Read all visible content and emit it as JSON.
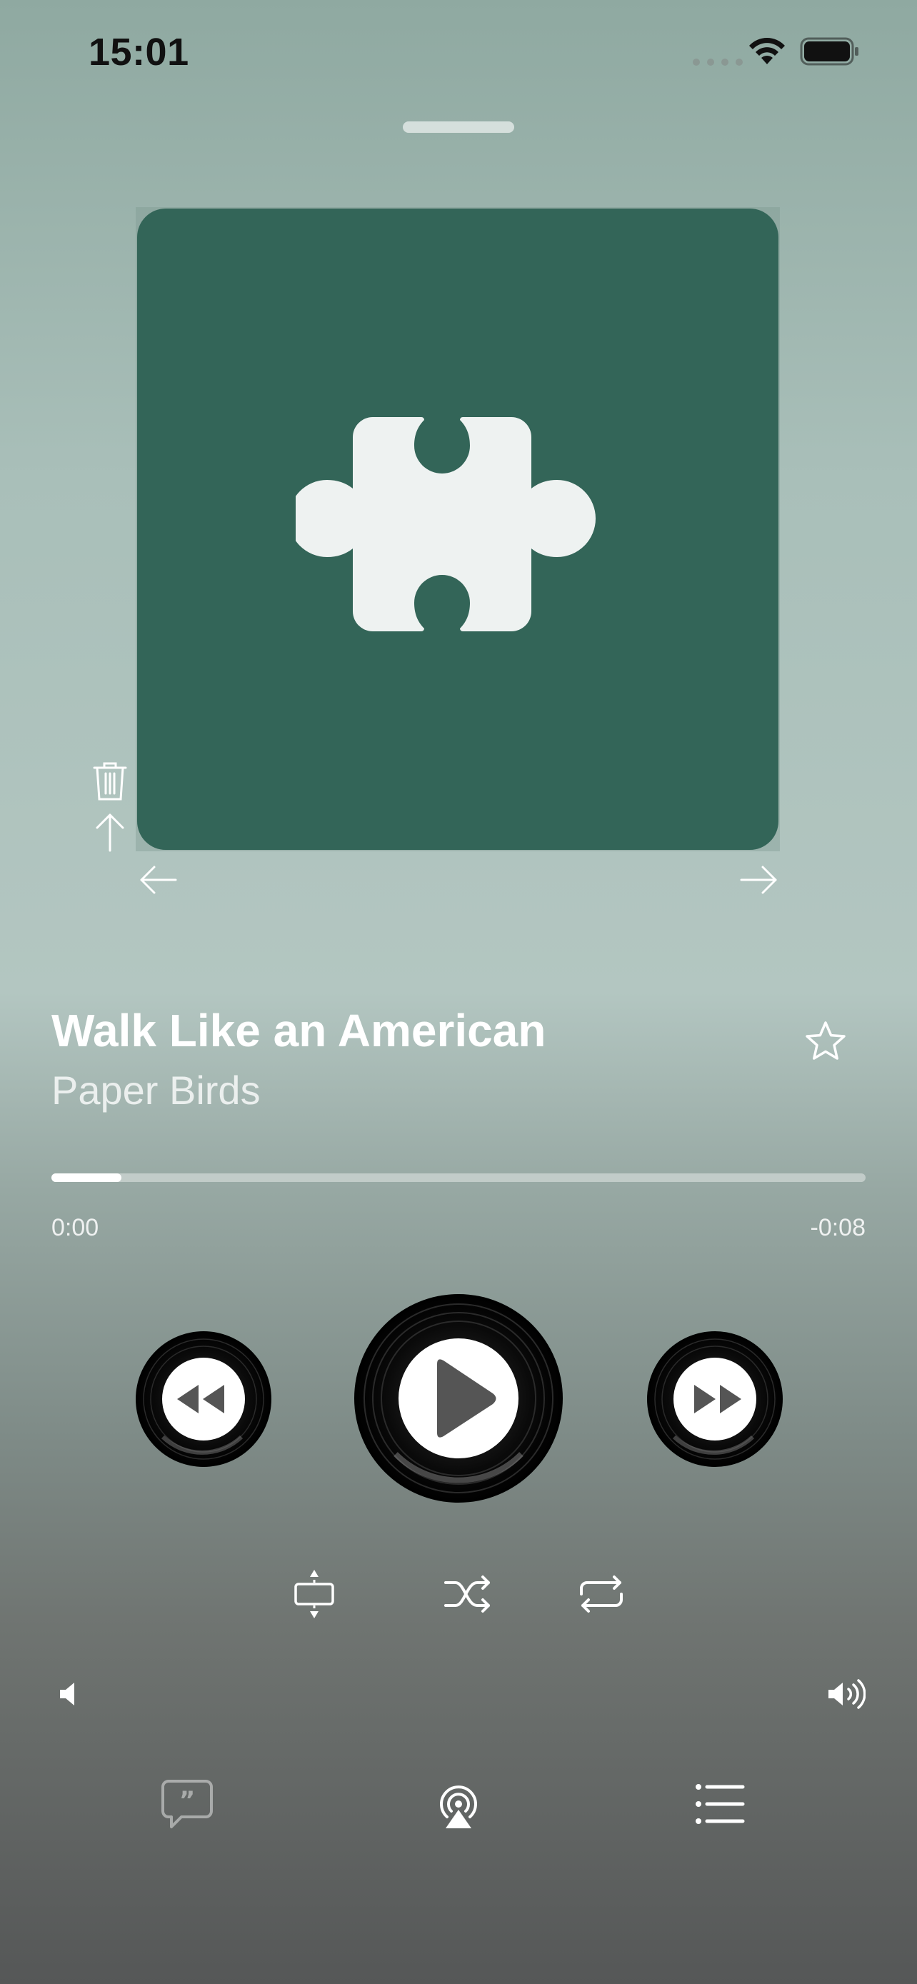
{
  "status_bar": {
    "time": "15:01",
    "icons": [
      "cellular-dots-icon",
      "wifi-icon",
      "battery-icon"
    ]
  },
  "artwork": {
    "background_color": "#336558",
    "icon": "puzzle-piece-icon",
    "icon_color": "#eef2f1"
  },
  "artwork_controls": [
    "trash-icon",
    "arrow-up-icon",
    "arrow-left-icon",
    "arrow-right-icon"
  ],
  "track": {
    "title": "Walk Like an American",
    "artist": "Paper Birds",
    "favorite_icon": "star-outline-icon"
  },
  "progress": {
    "elapsed": "0:00",
    "remaining": "-0:08",
    "fraction": 0.086
  },
  "transport": {
    "rewind_icon": "rewind-record-icon",
    "play_icon": "play-record-icon",
    "forward_icon": "fast-forward-record-icon"
  },
  "modes": [
    "autoplay-icon",
    "shuffle-icon",
    "repeat-icon"
  ],
  "volume": {
    "low_icon": "speaker-low-icon",
    "high_icon": "speaker-high-icon"
  },
  "bottom_bar": [
    "lyrics-icon",
    "airplay-icon",
    "queue-list-icon"
  ]
}
